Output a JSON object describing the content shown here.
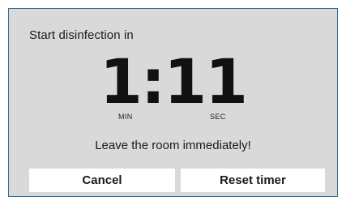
{
  "dialog": {
    "title": "Start disinfection in",
    "countdown": {
      "minutes": "1",
      "separator": ":",
      "seconds": "11",
      "min_unit": "MIN",
      "sec_unit": "SEC"
    },
    "message": "Leave the room immediately!",
    "buttons": {
      "cancel_label": "Cancel",
      "reset_label": "Reset timer"
    },
    "colors": {
      "background": "#d9d9d9",
      "border": "#2f6f97",
      "button_background": "#ffffff"
    }
  }
}
